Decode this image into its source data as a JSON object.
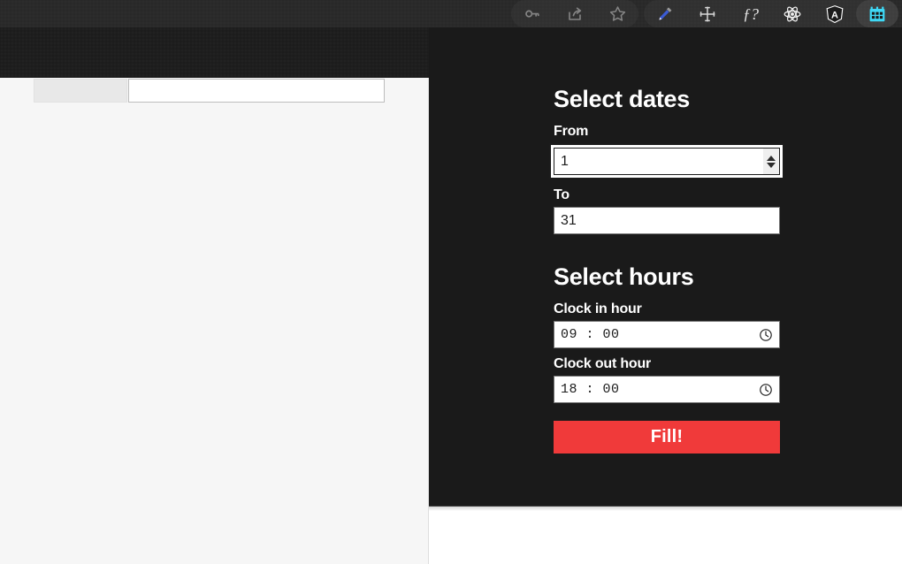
{
  "toolbar": {
    "left_icons": [
      {
        "name": "key-icon",
        "label": "Key"
      },
      {
        "name": "share-icon",
        "label": "Share"
      },
      {
        "name": "star-icon",
        "label": "Bookmark"
      }
    ],
    "right_icons": [
      {
        "name": "eyedropper-icon",
        "label": "Eyedropper"
      },
      {
        "name": "move-icon",
        "label": "Move"
      },
      {
        "name": "function-icon",
        "label": "f?"
      },
      {
        "name": "react-icon",
        "label": "React"
      },
      {
        "name": "angular-icon",
        "label": "Angular"
      },
      {
        "name": "calendar-icon",
        "label": "Calendar"
      }
    ],
    "accent_active": "#3fd8f5"
  },
  "panel": {
    "background": "#1a1a1a",
    "dates": {
      "heading": "Select dates",
      "from": {
        "label": "From",
        "value": "1",
        "focused": true
      },
      "to": {
        "label": "To",
        "value": "31",
        "focused": false
      }
    },
    "hours": {
      "heading": "Select hours",
      "clock_in": {
        "label": "Clock in hour",
        "value": "09 : 00"
      },
      "clock_out": {
        "label": "Clock out hour",
        "value": "18 : 00"
      }
    },
    "submit": {
      "label": "Fill!",
      "color": "#f03a3a"
    }
  }
}
